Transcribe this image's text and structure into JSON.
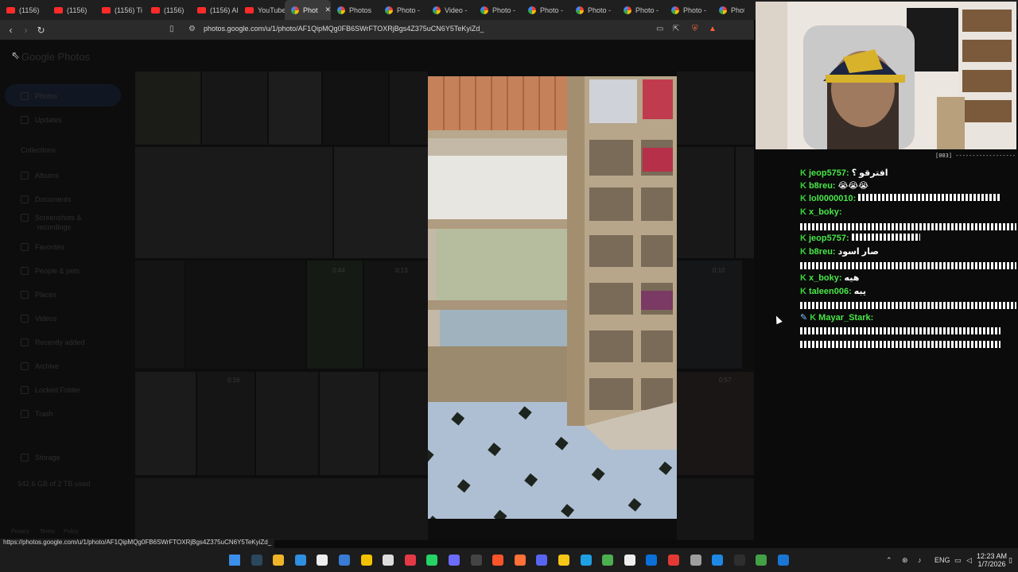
{
  "browser": {
    "tabs": [
      {
        "label": "(1156)",
        "favicon": "youtube-icon"
      },
      {
        "label": "(1156)",
        "favicon": "youtube-icon"
      },
      {
        "label": "(1156) Ti",
        "favicon": "youtube-icon"
      },
      {
        "label": "(1156)",
        "favicon": "youtube-icon"
      },
      {
        "label": "(1156) Al",
        "favicon": "youtube-icon"
      },
      {
        "label": "YouTube",
        "favicon": "youtube-icon"
      },
      {
        "label": "Phot",
        "favicon": "photos-icon",
        "active": true
      },
      {
        "label": "Photos",
        "favicon": "photos-icon"
      },
      {
        "label": "Photo -",
        "favicon": "photos-icon"
      },
      {
        "label": "Video -",
        "favicon": "photos-icon"
      },
      {
        "label": "Photo -",
        "favicon": "photos-icon"
      },
      {
        "label": "Photo -",
        "favicon": "photos-icon"
      },
      {
        "label": "Photo -",
        "favicon": "photos-icon"
      },
      {
        "label": "Photo -",
        "favicon": "photos-icon"
      },
      {
        "label": "Photo -",
        "favicon": "photos-icon"
      },
      {
        "label": "Photo",
        "favicon": "photos-icon"
      }
    ],
    "url": "photos.google.com/u/1/photo/AF1QipMQg0FB6SWrFTOXRjBgs4Z375uCN6Y5TeKyiZd_",
    "status_url": "https://photos.google.com/u/1/photo/AF1QipMQg0FB6SWrFTOXRjBgs4Z375uCN6Y5TeKyiZd_"
  },
  "photos": {
    "logo": "Google Photos",
    "sidebar": {
      "items": [
        {
          "label": "Photos"
        },
        {
          "label": "Updates"
        }
      ],
      "collections_heading": "Collections",
      "collections": [
        {
          "label": "Albums"
        },
        {
          "label": "Documents"
        },
        {
          "label": "Screenshots &"
        },
        {
          "label": "recordings"
        },
        {
          "label": "Favorites"
        },
        {
          "label": "People & pets"
        },
        {
          "label": "Places"
        },
        {
          "label": "Videos"
        },
        {
          "label": "Recently added"
        },
        {
          "label": "Archive"
        },
        {
          "label": "Locked Folder"
        },
        {
          "label": "Trash"
        }
      ],
      "storage_label": "Storage",
      "storage_used": "942.6 GB of 2 TB used",
      "footer": [
        "Privacy",
        "Terms",
        "Policy"
      ]
    },
    "video_durations": [
      "0:44",
      "0:13",
      "0:16",
      "0:57",
      "0:10"
    ]
  },
  "chat": {
    "header": "[003] ------------------",
    "messages": [
      {
        "user": "jeop5757:",
        "text": "افترقو ؟",
        "badge": "K"
      },
      {
        "user": "b8reu:",
        "text": "😭😭😭",
        "badge": "K"
      },
      {
        "user": "lol0000010:",
        "text": "",
        "badge": "K",
        "squiggle": 178
      },
      {
        "user": "x_boky:",
        "text": "",
        "badge": "K"
      },
      {
        "user": "",
        "text": "",
        "squiggle": 272
      },
      {
        "user": "jeop5757:",
        "text": "",
        "badge": "K",
        "squiggle": 86
      },
      {
        "user": "b8reu:",
        "text": "صار اسود",
        "badge": "K"
      },
      {
        "user": "",
        "text": "",
        "squiggle": 272
      },
      {
        "user": "x_boky:",
        "text": "هيه",
        "badge": "K"
      },
      {
        "user": "taleen006:",
        "text": "يبه",
        "badge": "K"
      },
      {
        "user": "",
        "text": "",
        "squiggle": 272
      },
      {
        "user": "Mayar_Stark:",
        "text": "",
        "badge": "K",
        "extra_badge": "sword-icon",
        "blue": true
      },
      {
        "user": "",
        "text": "",
        "squiggle": 252
      },
      {
        "user": "",
        "text": "",
        "squiggle": 252
      }
    ]
  },
  "taskbar": {
    "icons": [
      "windows-start-icon",
      "steam-icon",
      "file-explorer-icon",
      "edge-icon",
      "store-icon",
      "mail-icon",
      "notes-icon",
      "settings-icon",
      "media-icon",
      "whatsapp-icon",
      "terminal-icon",
      "obs-icon",
      "brave-icon",
      "app-icon",
      "discord-icon",
      "yellow-app-icon",
      "browser-icon",
      "chrome-icon",
      "notion-icon",
      "blue-app-icon",
      "red-app-icon",
      "gear-icon",
      "vpn-icon",
      "cmd-icon",
      "green-app-icon",
      "editor-icon"
    ],
    "language": "ENG",
    "time": "12:23 AM",
    "date": "1/7/2026"
  },
  "colors": {
    "chat_user": "#48e748",
    "chat_badge": "#3bd13b",
    "youtube": "#ff2b2b",
    "taskbar": "#1c1c1c"
  }
}
